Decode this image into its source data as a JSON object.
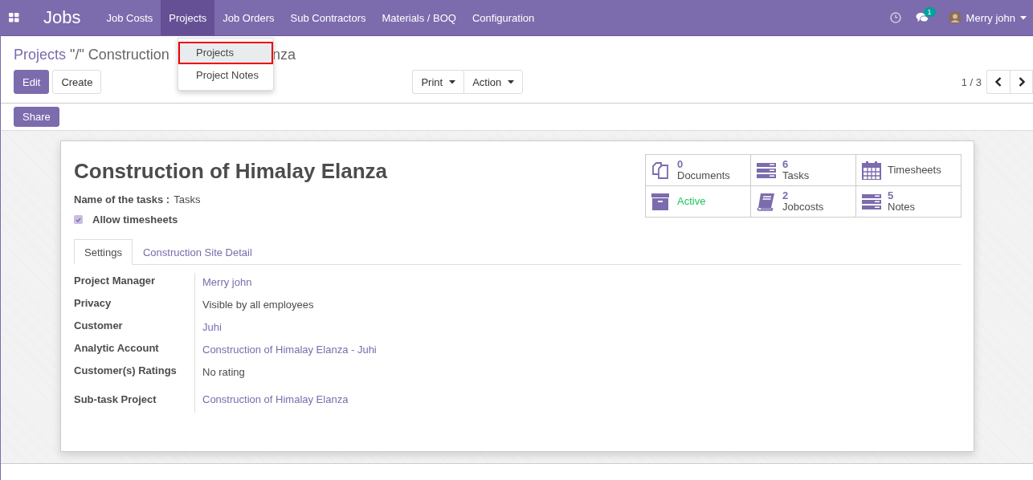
{
  "navbar": {
    "title": "Jobs",
    "menu": [
      {
        "label": "Job Costs",
        "selected": false
      },
      {
        "label": "Projects",
        "selected": true
      },
      {
        "label": "Job Orders",
        "selected": false
      },
      {
        "label": "Sub Contractors",
        "selected": false
      },
      {
        "label": "Materials / BOQ",
        "selected": false
      },
      {
        "label": "Configuration",
        "selected": false
      }
    ],
    "message_count": "1",
    "user": "Merry john"
  },
  "dropdown": {
    "items": [
      {
        "label": "Projects",
        "selected": true
      },
      {
        "label": "Project Notes",
        "selected": false
      }
    ]
  },
  "breadcrumb": {
    "parent": "Projects",
    "current_visible": "\"/\" Construction",
    "current_tail": "nza"
  },
  "control_panel": {
    "edit": "Edit",
    "create": "Create",
    "print": "Print",
    "action": "Action",
    "pager": "1 / 3",
    "share": "Share"
  },
  "form": {
    "title": "Construction of Himalay Elanza",
    "task_name_label": "Name of the tasks :",
    "task_name": "Tasks",
    "allow_timesheets": {
      "label": "Allow timesheets",
      "checked": true
    },
    "stats": [
      {
        "kind": "documents",
        "count": "0",
        "label": "Documents"
      },
      {
        "kind": "tasks",
        "count": "6",
        "label": "Tasks"
      },
      {
        "kind": "calendar",
        "label": "Timesheets"
      },
      {
        "kind": "archive",
        "label": "Active"
      },
      {
        "kind": "book",
        "count": "2",
        "label": "Jobcosts"
      },
      {
        "kind": "tasks",
        "count": "5",
        "label": "Notes"
      }
    ],
    "tabs": [
      {
        "label": "Settings",
        "selected": true
      },
      {
        "label": "Construction Site Detail",
        "selected": false
      }
    ],
    "fields": [
      {
        "label": "Project Manager",
        "value": "Merry john",
        "link": true
      },
      {
        "label": "Privacy",
        "value": "Visible by all employees",
        "link": false
      },
      {
        "label": "Customer",
        "value": "Juhi",
        "link": true
      },
      {
        "label": "Analytic Account",
        "value": "Construction of Himalay Elanza - Juhi",
        "link": true
      },
      {
        "label": "Customer(s) Ratings",
        "value": "No rating",
        "link": false
      },
      {
        "label": "Sub-task Project",
        "value": "Construction of Himalay Elanza",
        "link": true
      }
    ]
  }
}
